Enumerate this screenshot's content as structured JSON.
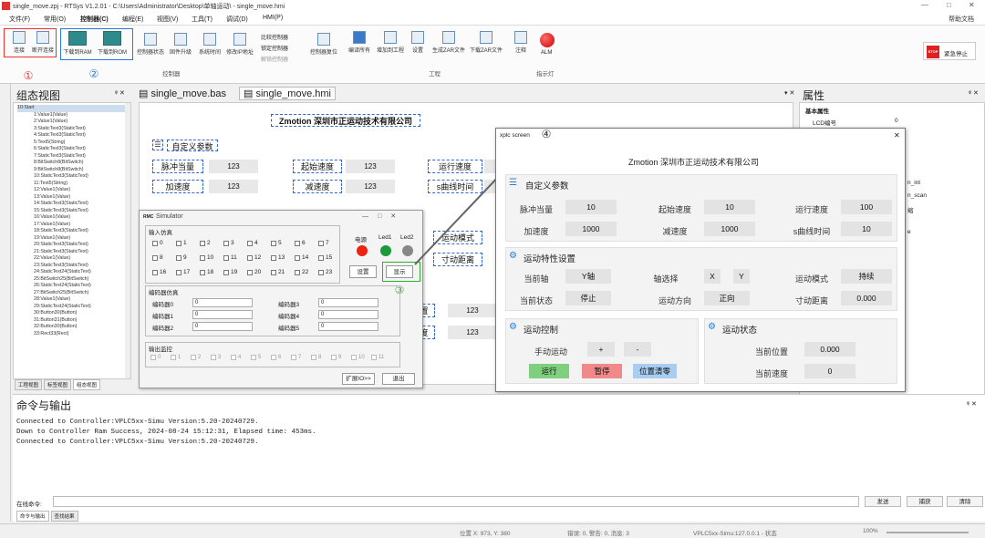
{
  "window": {
    "title": "single_move.zpj - RTSys V1.2.01 - C:\\Users\\Administrator\\Desktop\\单轴运动\\ - single_move.hmi"
  },
  "menu": [
    "文件(F)",
    "常用(O)",
    "控制器(C)",
    "编程(E)",
    "视图(V)",
    "工具(T)",
    "调试(D)",
    "HMI(P)"
  ],
  "help_label": "帮助文档",
  "ribbon": {
    "connect": "连接",
    "disconnect": "断开连接",
    "down_ram": "下载到RAM",
    "down_rom": "下载到ROM",
    "ctrl_status": "控制器状态",
    "fw_upgrade": "固件升级",
    "sys_time": "系统时间",
    "modify_ip": "修改IP地址",
    "compare": "比较控制器",
    "lock": "锁定控制器",
    "unlock": "解锁控制器",
    "ctrl_reset": "控制器复位",
    "compile_all": "编译所有",
    "add_to_project": "增加到工程",
    "settings": "设置",
    "gen_zar": "生成ZAR文件",
    "down_zar": "下载ZAR文件",
    "comment": "注释",
    "alm": "ALM",
    "estop": "紧急停止",
    "stop_ico": "STOP",
    "grp_controller": "控制器",
    "grp_project": "工程",
    "grp_indicator": "指示灯"
  },
  "badges": [
    "①",
    "②",
    "③",
    "④"
  ],
  "left_panel": {
    "title": "组态视图",
    "tree": [
      "10:Start",
      "1:Value1(Value)",
      "2:Value1(Value)",
      "3:StaticText3(StaticText)",
      "4:StaticText3(StaticText)",
      "5:Text5(String)",
      "6:StaticText3(StaticText)",
      "7:StaticText3(StaticText)",
      "8:BitSwitch8(BitSwitch)",
      "9:BitSwitch8(BitSwitch)",
      "10:StaticText3(StaticText)",
      "11:Text5(String)",
      "12:Value1(Value)",
      "13:Value1(Value)",
      "14:StaticText3(StaticText)",
      "15:StaticText3(StaticText)",
      "16:Value1(Value)",
      "17:Value1(Value)",
      "18:StaticText3(StaticText)",
      "19:Value1(Value)",
      "20:StaticText3(StaticText)",
      "21:StaticText3(StaticText)",
      "22:Value1(Value)",
      "23:StaticText3(StaticText)",
      "24:StaticText24(StaticText)",
      "25:BitSwitch25(BitSwitch)",
      "26:StaticText24(StaticText)",
      "27:BitSwitch25(BitSwitch)",
      "28:Value1(Value)",
      "29:StaticText24(StaticText)",
      "30:Button30(Button)",
      "31:Button31(Button)",
      "32:Button30(Button)",
      "33:Rect33(Rect)"
    ],
    "tabs": [
      "工程视图",
      "标签视图",
      "组态视图"
    ]
  },
  "doc_tabs": [
    "single_move.bas",
    "single_move.hmi"
  ],
  "hmi": {
    "company": "Zmotion  深圳市正运动技术有限公司",
    "section1": "自定义参数",
    "labels": [
      "脉冲当量",
      "起始速度",
      "运行速度",
      "加速度",
      "减速度",
      "s曲线时间",
      "运动模式",
      "寸动距离",
      "置",
      "度"
    ],
    "val": "123"
  },
  "props": {
    "title": "属性",
    "group": "基本属性",
    "lcd_label": "LCD编号",
    "lcd_val": "0",
    "frag": [
      "n_int",
      "n_scan",
      "缩",
      "e"
    ]
  },
  "sim": {
    "title": "Simulator",
    "in_title": "输入仿真",
    "inputs": [
      "0",
      "1",
      "2",
      "3",
      "4",
      "5",
      "6",
      "7",
      "8",
      "9",
      "10",
      "11",
      "12",
      "13",
      "14",
      "15",
      "16",
      "17",
      "18",
      "19",
      "20",
      "21",
      "22",
      "23"
    ],
    "power": "电源",
    "led1": "Led1",
    "led2": "Led2",
    "settings": "设置",
    "display": "显示",
    "enc_title": "编码器仿真",
    "encoders": [
      {
        "l": "编码器0",
        "v": "0"
      },
      {
        "l": "编码器1",
        "v": "0"
      },
      {
        "l": "编码器2",
        "v": "0"
      },
      {
        "l": "编码器3",
        "v": "0"
      },
      {
        "l": "编码器4",
        "v": "0"
      },
      {
        "l": "编码器5",
        "v": "0"
      }
    ],
    "out_title": "输出监控",
    "outputs": [
      "0",
      "1",
      "2",
      "3",
      "4",
      "5",
      "6",
      "7",
      "8",
      "9",
      "10",
      "11"
    ],
    "expand": "扩展IO>>",
    "exit": "退出"
  },
  "xplc": {
    "title": "xplc screen",
    "company": "Zmotion  深圳市正运动技术有限公司",
    "s1": "自定义参数",
    "p1": [
      {
        "l": "脉冲当量",
        "v": "10"
      },
      {
        "l": "起始速度",
        "v": "10"
      },
      {
        "l": "运行速度",
        "v": "100"
      },
      {
        "l": "加速度",
        "v": "1000"
      },
      {
        "l": "减速度",
        "v": "1000"
      },
      {
        "l": "s曲线时间",
        "v": "10"
      }
    ],
    "s2": "运动特性设置",
    "cur_axis": "当前轴",
    "cur_axis_v": "Y轴",
    "axis_sel": "轴选择",
    "x": "X",
    "y": "Y",
    "mode": "运动模式",
    "mode_v": "持续",
    "cur_state": "当前状态",
    "cur_state_v": "停止",
    "dir": "运动方向",
    "dir_v": "正向",
    "jog": "寸动距离",
    "jog_v": "0.000",
    "s3": "运动控制",
    "manual": "手动运动",
    "plus": "+",
    "minus": "-",
    "run": "运行",
    "pause": "暂停",
    "clear": "位置清零",
    "s4": "运动状态",
    "pos": "当前位置",
    "pos_v": "0.000",
    "spd": "当前速度",
    "spd_v": "0"
  },
  "cmd": {
    "title": "命令与输出",
    "lines": [
      "Connected to Controller:VPLC5xx-Simu Version:5.20-20240729.",
      "Down to Controller Ram Success, 2024-08-24 15:12:31, Elapsed time: 453ms.",
      "Connected to Controller:VPLC5xx-Simu Version:5.20-20240729."
    ],
    "online": "在线命令:",
    "send": "发送",
    "capture": "捕获",
    "clear": "清除",
    "tabs": [
      "命令与输出",
      "查找结果"
    ]
  },
  "status": {
    "pos": "位置 X: 973, Y: 380",
    "err": "错误: 0, 警告: 0, 消息: 3",
    "ctrl": "VPLC5xx-Simu:127.0.0.1 - 状态",
    "zoom": "100%"
  },
  "colors": {
    "accent": "#2a7bd6",
    "badge": "#e33333",
    "run": "#7ed07e",
    "pause": "#f08a8a",
    "clear": "#a9cdf0"
  }
}
